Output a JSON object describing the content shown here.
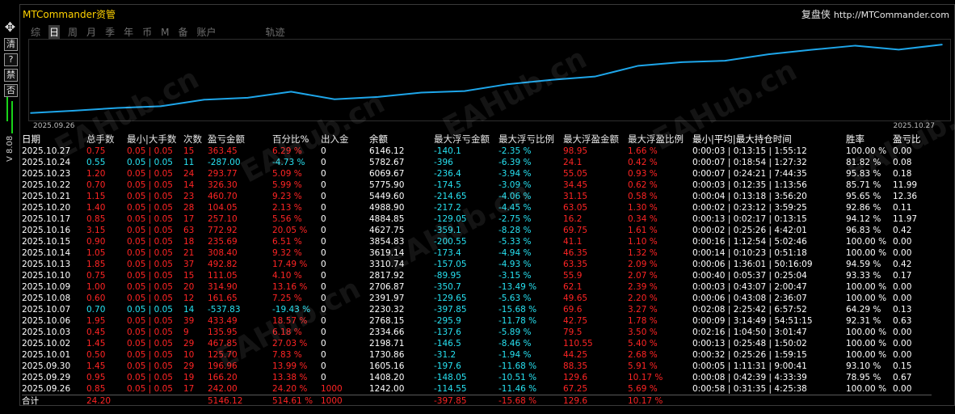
{
  "app_title": "MTCommander资管",
  "brand": {
    "cn": "复盘侠",
    "url": "http://MTCommander.com"
  },
  "left_buttons": [
    "清",
    "?",
    "禁",
    "否"
  ],
  "version": "V 8.08",
  "tabs": [
    {
      "label": "综",
      "active": false
    },
    {
      "label": "日",
      "active": true
    },
    {
      "label": "周",
      "active": false
    },
    {
      "label": "月",
      "active": false
    },
    {
      "label": "季",
      "active": false
    },
    {
      "label": "年",
      "active": false
    },
    {
      "label": "币",
      "active": false
    },
    {
      "label": "M",
      "active": false
    },
    {
      "label": "备",
      "active": false
    },
    {
      "label": "账户",
      "active": false
    },
    {
      "label": "轨迹",
      "active": false
    }
  ],
  "chart_data": {
    "type": "line",
    "x_start_label": "2025.09.26",
    "x_end_label": "2025.10.27",
    "x": [
      "2025.09.26",
      "2025.09.29",
      "2025.09.30",
      "2025.10.01",
      "2025.10.02",
      "2025.10.03",
      "2025.10.06",
      "2025.10.07",
      "2025.10.08",
      "2025.10.09",
      "2025.10.10",
      "2025.10.13",
      "2025.10.14",
      "2025.10.15",
      "2025.10.16",
      "2025.10.17",
      "2025.10.20",
      "2025.10.21",
      "2025.10.22",
      "2025.10.23",
      "2025.10.24",
      "2025.10.27"
    ],
    "values": [
      1242.0,
      1408.2,
      1605.16,
      1730.86,
      2198.71,
      2334.66,
      2768.15,
      2230.32,
      2391.97,
      2706.87,
      2817.92,
      3310.74,
      3619.14,
      3854.83,
      4627.75,
      4884.85,
      4988.9,
      5449.6,
      5775.9,
      6069.67,
      5782.67,
      6146.12
    ],
    "color": "#1ea6ea"
  },
  "table": {
    "headers": [
      "日期",
      "总手数",
      "最小|大手数",
      "次数",
      "盈亏金额",
      "百分比%",
      "出入金",
      "余额",
      "最大浮亏金额",
      "最大浮亏比例",
      "最大浮盈金额",
      "最大浮盈比例",
      "最小|平均|最大持仓时间",
      "胜率",
      "盈亏比"
    ],
    "rows": [
      {
        "cells": [
          "2025.10.27",
          "0.75",
          "0.05 | 0.05",
          "15",
          "363.45",
          "6.29 %",
          "0",
          "6146.12",
          "-140.1",
          "-2.35 %",
          "98.95",
          "1.66 %",
          "0:00:03 | 0:13:15 | 1:55:12",
          "100.00 %",
          "0.00"
        ],
        "colors": [
          "w",
          "r",
          "r",
          "r",
          "r",
          "r",
          "w",
          "w",
          "c",
          "c",
          "r",
          "r",
          "w",
          "w",
          "w"
        ]
      },
      {
        "cells": [
          "2025.10.24",
          "0.55",
          "0.05 | 0.05",
          "11",
          "-287.00",
          "-4.73 %",
          "0",
          "5782.67",
          "-396",
          "-6.39 %",
          "24.1",
          "0.42 %",
          "0:00:07 | 0:18:54 | 1:27:32",
          "81.82 %",
          "0.08"
        ],
        "colors": [
          "w",
          "c",
          "c",
          "c",
          "c",
          "c",
          "w",
          "w",
          "c",
          "c",
          "r",
          "r",
          "w",
          "w",
          "w"
        ]
      },
      {
        "cells": [
          "2025.10.23",
          "1.20",
          "0.05 | 0.05",
          "24",
          "293.77",
          "5.09 %",
          "0",
          "6069.67",
          "-236.4",
          "-3.94 %",
          "55.05",
          "0.93 %",
          "0:00:07 | 0:24:21 | 7:44:35",
          "95.83 %",
          "0.18"
        ],
        "colors": [
          "w",
          "r",
          "r",
          "r",
          "r",
          "r",
          "w",
          "w",
          "c",
          "c",
          "r",
          "r",
          "w",
          "w",
          "w"
        ]
      },
      {
        "cells": [
          "2025.10.22",
          "0.70",
          "0.05 | 0.05",
          "14",
          "326.30",
          "5.99 %",
          "0",
          "5775.90",
          "-174.5",
          "-3.09 %",
          "34.45",
          "0.62 %",
          "0:00:03 | 0:12:35 | 1:13:56",
          "85.71 %",
          "11.99"
        ],
        "colors": [
          "w",
          "r",
          "r",
          "r",
          "r",
          "r",
          "w",
          "w",
          "c",
          "c",
          "r",
          "r",
          "w",
          "w",
          "w"
        ]
      },
      {
        "cells": [
          "2025.10.21",
          "1.15",
          "0.05 | 0.05",
          "23",
          "460.70",
          "9.23 %",
          "0",
          "5449.60",
          "-214.65",
          "-4.06 %",
          "31.15",
          "0.58 %",
          "0:00:04 | 0:13:18 | 3:56:20",
          "95.65 %",
          "12.36"
        ],
        "colors": [
          "w",
          "r",
          "r",
          "r",
          "r",
          "r",
          "w",
          "w",
          "c",
          "c",
          "r",
          "r",
          "w",
          "w",
          "w"
        ]
      },
      {
        "cells": [
          "2025.10.20",
          "1.40",
          "0.05 | 0.05",
          "28",
          "104.05",
          "2.13 %",
          "0",
          "4988.90",
          "-217.2",
          "-4.45 %",
          "63.05",
          "1.30 %",
          "0:00:02 | 0:23:12 | 3:59:25",
          "92.86 %",
          "0.11"
        ],
        "colors": [
          "w",
          "r",
          "r",
          "r",
          "r",
          "r",
          "w",
          "w",
          "c",
          "c",
          "r",
          "r",
          "w",
          "w",
          "w"
        ]
      },
      {
        "cells": [
          "2025.10.17",
          "0.85",
          "0.05 | 0.05",
          "17",
          "257.10",
          "5.56 %",
          "0",
          "4884.85",
          "-129.05",
          "-2.75 %",
          "16.2",
          "0.34 %",
          "0:00:13 | 0:02:17 | 0:13:15",
          "94.12 %",
          "11.97"
        ],
        "colors": [
          "w",
          "r",
          "r",
          "r",
          "r",
          "r",
          "w",
          "w",
          "c",
          "c",
          "r",
          "r",
          "w",
          "w",
          "w"
        ]
      },
      {
        "cells": [
          "2025.10.16",
          "3.15",
          "0.05 | 0.05",
          "63",
          "772.92",
          "20.05 %",
          "0",
          "4627.75",
          "-359.1",
          "-8.28 %",
          "69.75",
          "1.61 %",
          "0:00:02 | 0:25:26 | 4:42:01",
          "96.83 %",
          "0.42"
        ],
        "colors": [
          "w",
          "r",
          "r",
          "r",
          "r",
          "r",
          "w",
          "w",
          "c",
          "c",
          "r",
          "r",
          "w",
          "w",
          "w"
        ]
      },
      {
        "cells": [
          "2025.10.15",
          "0.90",
          "0.05 | 0.05",
          "18",
          "235.69",
          "6.51 %",
          "0",
          "3854.83",
          "-200.55",
          "-5.33 %",
          "41.1",
          "1.10 %",
          "0:00:16 | 1:12:54 | 5:02:46",
          "100.00 %",
          "0.00"
        ],
        "colors": [
          "w",
          "r",
          "r",
          "r",
          "r",
          "r",
          "w",
          "w",
          "c",
          "c",
          "r",
          "r",
          "w",
          "w",
          "w"
        ]
      },
      {
        "cells": [
          "2025.10.14",
          "1.05",
          "0.05 | 0.05",
          "21",
          "308.40",
          "9.32 %",
          "0",
          "3619.14",
          "-173.4",
          "-4.94 %",
          "46.35",
          "1.32 %",
          "0:00:14 | 0:10:23 | 0:51:18",
          "100.00 %",
          "0.00"
        ],
        "colors": [
          "w",
          "r",
          "r",
          "r",
          "r",
          "r",
          "w",
          "w",
          "c",
          "c",
          "r",
          "r",
          "w",
          "w",
          "w"
        ]
      },
      {
        "cells": [
          "2025.10.13",
          "1.85",
          "0.05 | 0.05",
          "37",
          "492.82",
          "17.49 %",
          "0",
          "3310.74",
          "-157.05",
          "-4.93 %",
          "63.35",
          "2.09 %",
          "0:00:06 | 1:36:01 | 50:16:09",
          "94.59 %",
          "0.42"
        ],
        "colors": [
          "w",
          "r",
          "r",
          "r",
          "r",
          "r",
          "w",
          "w",
          "c",
          "c",
          "r",
          "r",
          "w",
          "w",
          "w"
        ]
      },
      {
        "cells": [
          "2025.10.10",
          "0.75",
          "0.05 | 0.05",
          "15",
          "111.05",
          "4.10 %",
          "0",
          "2817.92",
          "-89.95",
          "-3.15 %",
          "55.9",
          "2.07 %",
          "0:00:40 | 0:05:37 | 0:25:04",
          "93.33 %",
          "0.17"
        ],
        "colors": [
          "w",
          "r",
          "r",
          "r",
          "r",
          "r",
          "w",
          "w",
          "c",
          "c",
          "r",
          "r",
          "w",
          "w",
          "w"
        ]
      },
      {
        "cells": [
          "2025.10.09",
          "1.00",
          "0.05 | 0.05",
          "20",
          "314.90",
          "13.16 %",
          "0",
          "2706.87",
          "-350.7",
          "-13.49 %",
          "62.1",
          "2.39 %",
          "0:00:03 | 0:43:07 | 2:00:47",
          "100.00 %",
          "0.00"
        ],
        "colors": [
          "w",
          "r",
          "r",
          "r",
          "r",
          "r",
          "w",
          "w",
          "c",
          "c",
          "r",
          "r",
          "w",
          "w",
          "w"
        ]
      },
      {
        "cells": [
          "2025.10.08",
          "0.60",
          "0.05 | 0.05",
          "12",
          "161.65",
          "7.25 %",
          "0",
          "2391.97",
          "-129.65",
          "-5.63 %",
          "49.65",
          "2.20 %",
          "0:00:06 | 0:43:08 | 2:36:07",
          "100.00 %",
          "0.00"
        ],
        "colors": [
          "w",
          "r",
          "r",
          "r",
          "r",
          "r",
          "w",
          "w",
          "c",
          "c",
          "r",
          "r",
          "w",
          "w",
          "w"
        ]
      },
      {
        "cells": [
          "2025.10.07",
          "0.70",
          "0.05 | 0.05",
          "14",
          "-537.83",
          "-19.43 %",
          "0",
          "2230.32",
          "-397.85",
          "-15.68 %",
          "69.6",
          "3.27 %",
          "0:02:08 | 2:25:42 | 6:57:52",
          "64.29 %",
          "0.13"
        ],
        "colors": [
          "w",
          "c",
          "c",
          "c",
          "c",
          "c",
          "w",
          "w",
          "c",
          "c",
          "r",
          "r",
          "w",
          "w",
          "w"
        ]
      },
      {
        "cells": [
          "2025.10.06",
          "1.95",
          "0.05 | 0.05",
          "39",
          "433.49",
          "18.57 %",
          "0",
          "2768.15",
          "-295.9",
          "-11.78 %",
          "42.75",
          "1.78 %",
          "0:00:09 | 3:14:49 | 54:51:15",
          "92.31 %",
          "0.63"
        ],
        "colors": [
          "w",
          "r",
          "r",
          "r",
          "r",
          "r",
          "w",
          "w",
          "c",
          "c",
          "r",
          "r",
          "w",
          "w",
          "w"
        ]
      },
      {
        "cells": [
          "2025.10.03",
          "0.45",
          "0.05 | 0.05",
          "9",
          "135.95",
          "6.18 %",
          "0",
          "2334.66",
          "-137.6",
          "-5.89 %",
          "79.5",
          "3.50 %",
          "0:02:16 | 1:04:50 | 3:01:47",
          "100.00 %",
          "0.00"
        ],
        "colors": [
          "w",
          "r",
          "r",
          "r",
          "r",
          "r",
          "w",
          "w",
          "c",
          "c",
          "r",
          "r",
          "w",
          "w",
          "w"
        ]
      },
      {
        "cells": [
          "2025.10.02",
          "1.45",
          "0.05 | 0.05",
          "29",
          "467.85",
          "27.03 %",
          "0",
          "2198.71",
          "-146.5",
          "-8.46 %",
          "110.55",
          "5.40 %",
          "0:00:13 | 0:25:48 | 1:50:02",
          "100.00 %",
          "0.00"
        ],
        "colors": [
          "w",
          "r",
          "r",
          "r",
          "r",
          "r",
          "w",
          "w",
          "c",
          "c",
          "r",
          "r",
          "w",
          "w",
          "w"
        ]
      },
      {
        "cells": [
          "2025.10.01",
          "0.50",
          "0.05 | 0.05",
          "10",
          "125.70",
          "7.83 %",
          "0",
          "1730.86",
          "-31.2",
          "-1.94 %",
          "44.25",
          "2.68 %",
          "0:00:32 | 0:25:26 | 1:59:15",
          "100.00 %",
          "0.00"
        ],
        "colors": [
          "w",
          "r",
          "r",
          "r",
          "r",
          "r",
          "w",
          "w",
          "c",
          "c",
          "r",
          "r",
          "w",
          "w",
          "w"
        ]
      },
      {
        "cells": [
          "2025.09.30",
          "1.45",
          "0.05 | 0.05",
          "29",
          "196.96",
          "13.99 %",
          "0",
          "1605.16",
          "-197.6",
          "-11.68 %",
          "88.35",
          "5.91 %",
          "0:00:05 | 1:11:31 | 9:00:41",
          "93.10 %",
          "0.15"
        ],
        "colors": [
          "w",
          "r",
          "r",
          "r",
          "r",
          "r",
          "w",
          "w",
          "c",
          "c",
          "r",
          "r",
          "w",
          "w",
          "w"
        ]
      },
      {
        "cells": [
          "2025.09.29",
          "0.95",
          "0.05 | 0.05",
          "19",
          "166.20",
          "13.38 %",
          "0",
          "1408.20",
          "-148.05",
          "-10.51 %",
          "129.6",
          "10.17 %",
          "0:00:08 | 0:42:39 | 4:33:39",
          "78.95 %",
          "0.67"
        ],
        "colors": [
          "w",
          "r",
          "r",
          "r",
          "r",
          "r",
          "w",
          "w",
          "c",
          "c",
          "r",
          "r",
          "w",
          "w",
          "w"
        ]
      },
      {
        "cells": [
          "2025.09.26",
          "0.85",
          "0.05 | 0.05",
          "17",
          "242.00",
          "24.20 %",
          "1000",
          "1242.00",
          "-114.55",
          "-11.46 %",
          "67.25",
          "5.69 %",
          "0:00:58 | 0:31:35 | 4:25:38",
          "100.00 %",
          "0.00"
        ],
        "colors": [
          "w",
          "r",
          "r",
          "r",
          "r",
          "r",
          "r",
          "w",
          "c",
          "c",
          "r",
          "r",
          "w",
          "w",
          "w"
        ]
      }
    ],
    "summary": {
      "cells": [
        "合计",
        "24.20",
        "",
        "",
        "5146.12",
        "514.61 %",
        "1000",
        "",
        "-397.85",
        "-15.68 %",
        "129.6",
        "10.17 %",
        "",
        "",
        ""
      ]
    }
  },
  "watermark": "EAHub.cn"
}
